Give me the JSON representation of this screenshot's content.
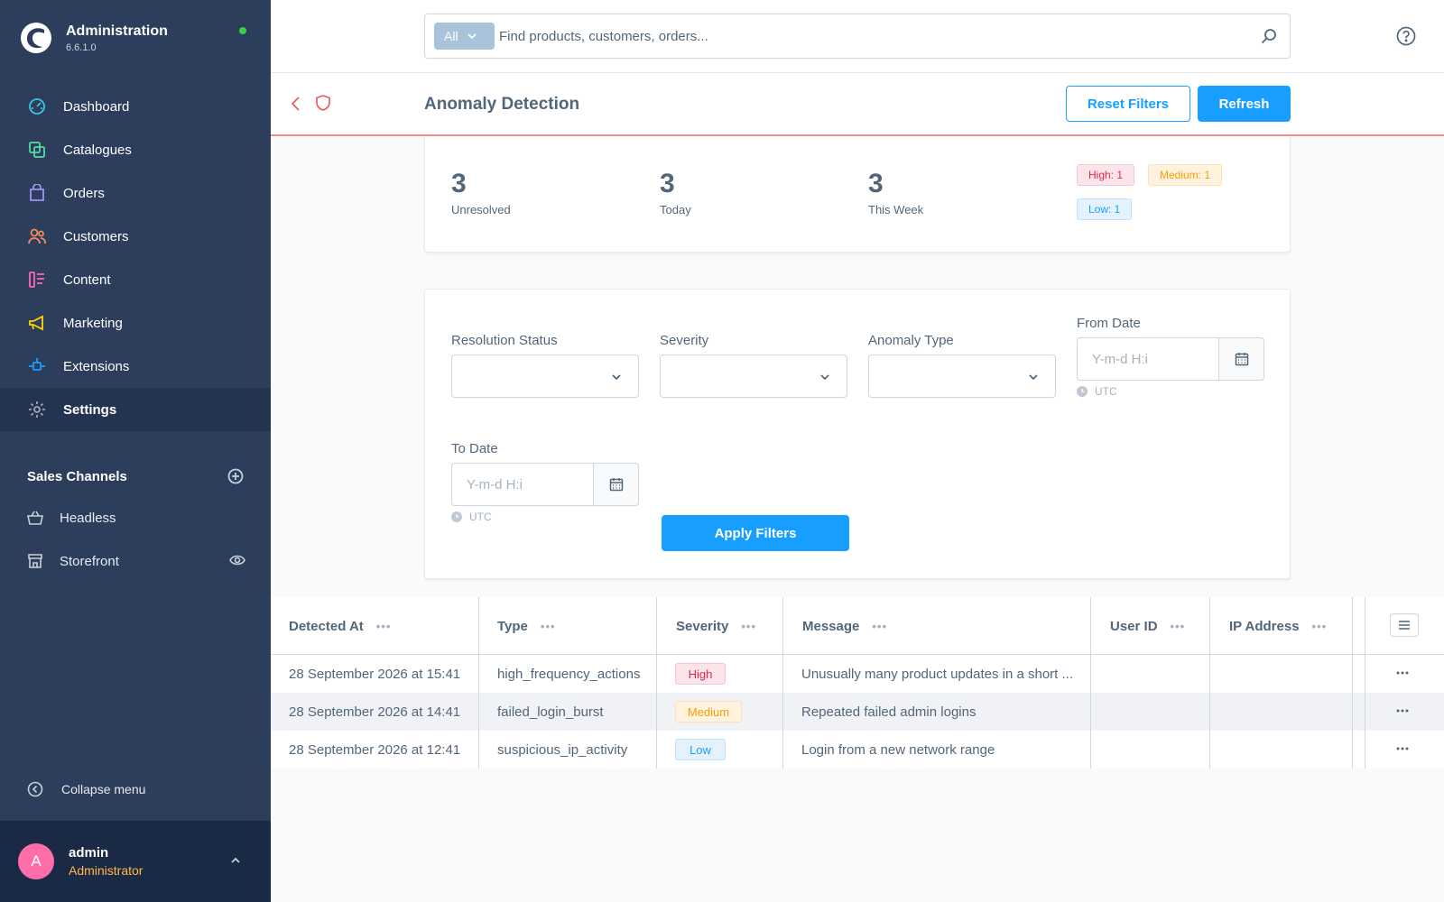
{
  "app": {
    "title": "Administration",
    "version": "6.6.1.0",
    "status_color": "#37d046"
  },
  "nav": {
    "items": [
      {
        "label": "Dashboard",
        "icon": "dashboard-icon",
        "color": "#3ec6e0"
      },
      {
        "label": "Catalogues",
        "icon": "catalogue-icon",
        "color": "#57d9a3"
      },
      {
        "label": "Orders",
        "icon": "orders-icon",
        "color": "#a092f0"
      },
      {
        "label": "Customers",
        "icon": "customers-icon",
        "color": "#f88962"
      },
      {
        "label": "Content",
        "icon": "content-icon",
        "color": "#ff68b4"
      },
      {
        "label": "Marketing",
        "icon": "marketing-icon",
        "color": "#ffd700"
      },
      {
        "label": "Extensions",
        "icon": "extensions-icon",
        "color": "#189eff"
      },
      {
        "label": "Settings",
        "icon": "settings-icon",
        "color": "#9aa8b5",
        "active": true
      }
    ],
    "sales_channels_title": "Sales Channels",
    "channels": [
      {
        "label": "Headless",
        "icon": "basket-icon"
      },
      {
        "label": "Storefront",
        "icon": "storefront-icon",
        "visibility_icon": "eye-icon"
      }
    ],
    "collapse_label": "Collapse menu"
  },
  "user": {
    "initial": "A",
    "name": "admin",
    "role": "Administrator",
    "avatar_color": "#ff6ea8"
  },
  "search": {
    "type_label": "All",
    "placeholder": "Find products, customers, orders..."
  },
  "page": {
    "title": "Anomaly Detection",
    "reset_label": "Reset Filters",
    "refresh_label": "Refresh",
    "accent": "#189eff"
  },
  "stats": {
    "unresolved": {
      "value": "3",
      "label": "Unresolved"
    },
    "today": {
      "value": "3",
      "label": "Today"
    },
    "week": {
      "value": "3",
      "label": "This Week"
    },
    "badges": {
      "high": "High: 1",
      "medium": "Medium: 1",
      "low": "Low: 1"
    }
  },
  "filters": {
    "resolution_label": "Resolution Status",
    "severity_label": "Severity",
    "type_label": "Anomaly Type",
    "from_label": "From Date",
    "to_label": "To Date",
    "date_placeholder": "Y-m-d H:i",
    "timezone": "UTC",
    "apply_label": "Apply Filters"
  },
  "grid": {
    "columns": [
      "Detected At",
      "Type",
      "Severity",
      "Message",
      "User ID",
      "IP Address"
    ],
    "rows": [
      {
        "detected_at": "28 September 2026 at 15:41",
        "type": "high_frequency_actions",
        "severity": "High",
        "severity_level": "high",
        "message": "Unusually many product updates in a short ...",
        "user_id": "",
        "ip": ""
      },
      {
        "detected_at": "28 September 2026 at 14:41",
        "type": "failed_login_burst",
        "severity": "Medium",
        "severity_level": "medium",
        "message": "Repeated failed admin logins",
        "user_id": "",
        "ip": ""
      },
      {
        "detected_at": "28 September 2026 at 12:41",
        "type": "suspicious_ip_activity",
        "severity": "Low",
        "severity_level": "low",
        "message": "Login from a new network range",
        "user_id": "",
        "ip": ""
      }
    ]
  }
}
